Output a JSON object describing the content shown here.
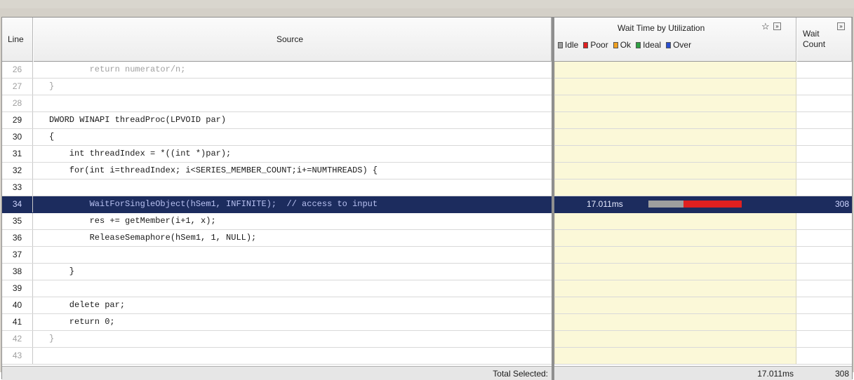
{
  "headers": {
    "line": "Line",
    "source": "Source",
    "wait_time": "Wait Time by Utilization",
    "wait_count_1": "Wait",
    "wait_count_2": "Count"
  },
  "legend": [
    {
      "label": "Idle",
      "color": "#9e9e9e"
    },
    {
      "label": "Poor",
      "color": "#e02020"
    },
    {
      "label": "Ok",
      "color": "#f0a020"
    },
    {
      "label": "Ideal",
      "color": "#2ea043"
    },
    {
      "label": "Over",
      "color": "#2a4fd0"
    }
  ],
  "icons": {
    "star": "star-icon",
    "expand": "expand-panel-icon"
  },
  "rows": [
    {
      "line": "26",
      "code": "        return numerator/n;",
      "dim": true
    },
    {
      "line": "27",
      "code": "}",
      "dim": true
    },
    {
      "line": "28",
      "code": "",
      "dim": true
    },
    {
      "line": "29",
      "code": "DWORD WINAPI threadProc(LPVOID par)"
    },
    {
      "line": "30",
      "code": "{"
    },
    {
      "line": "31",
      "code": "    int threadIndex = *((int *)par);"
    },
    {
      "line": "32",
      "code": "    for(int i=threadIndex; i<SERIES_MEMBER_COUNT;i+=NUMTHREADS) {"
    },
    {
      "line": "33",
      "code": ""
    },
    {
      "line": "34",
      "code": "        WaitForSingleObject(hSem1, INFINITE);  // access to input",
      "selected": true,
      "wait_time": "17.011ms",
      "wait_count": "308",
      "idle_fraction": 0.27,
      "poor_fraction": 0.45
    },
    {
      "line": "35",
      "code": "        res += getMember(i+1, x);"
    },
    {
      "line": "36",
      "code": "        ReleaseSemaphore(hSem1, 1, NULL);"
    },
    {
      "line": "37",
      "code": ""
    },
    {
      "line": "38",
      "code": "    }"
    },
    {
      "line": "39",
      "code": ""
    },
    {
      "line": "40",
      "code": "    delete par;"
    },
    {
      "line": "41",
      "code": "    return 0;"
    },
    {
      "line": "42",
      "code": "}",
      "dim": true
    },
    {
      "line": "43",
      "code": "",
      "dim": true
    }
  ],
  "footer": {
    "label": "Total Selected:",
    "wait_time": "17.011ms",
    "wait_count": "308"
  }
}
